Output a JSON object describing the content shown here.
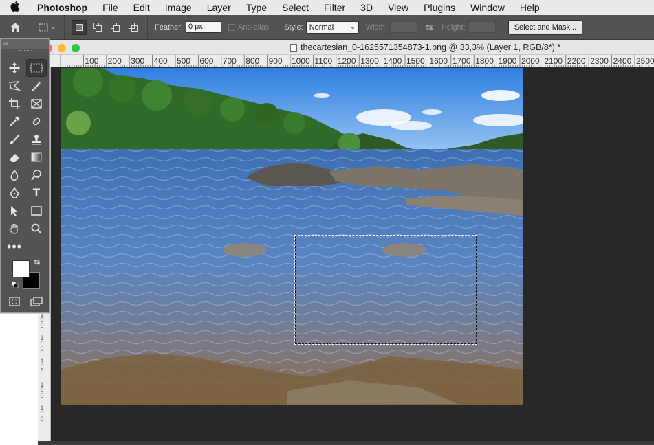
{
  "menubar": {
    "app_name": "Photoshop",
    "items": [
      "File",
      "Edit",
      "Image",
      "Layer",
      "Type",
      "Select",
      "Filter",
      "3D",
      "View",
      "Plugins",
      "Window",
      "Help"
    ]
  },
  "options_bar": {
    "feather_label": "Feather:",
    "feather_value": "0 px",
    "antialias_label": "Anti-alias",
    "style_label": "Style:",
    "style_value": "Normal",
    "width_label": "Width:",
    "height_label": "Height:",
    "select_mask_label": "Select and Mask..."
  },
  "document": {
    "title": "thecartesian_0-1625571354873-1.png @ 33,3% (Layer 1, RGB/8*) *"
  },
  "ruler": {
    "h_labels": [
      "100",
      "200",
      "300",
      "400",
      "500",
      "600",
      "700",
      "800",
      "900",
      "1000",
      "1100",
      "1200",
      "1300",
      "1400",
      "1500",
      "1600",
      "1700",
      "1800",
      "1900",
      "2000",
      "2100",
      "2200",
      "2300",
      "2400",
      "2500"
    ]
  },
  "tools_panel": {
    "collapse_label": "‹‹"
  },
  "colors": {
    "foreground": "#ffffff",
    "background": "#000000",
    "ui_panel": "#535353",
    "menubar": "#e9e9e9"
  }
}
